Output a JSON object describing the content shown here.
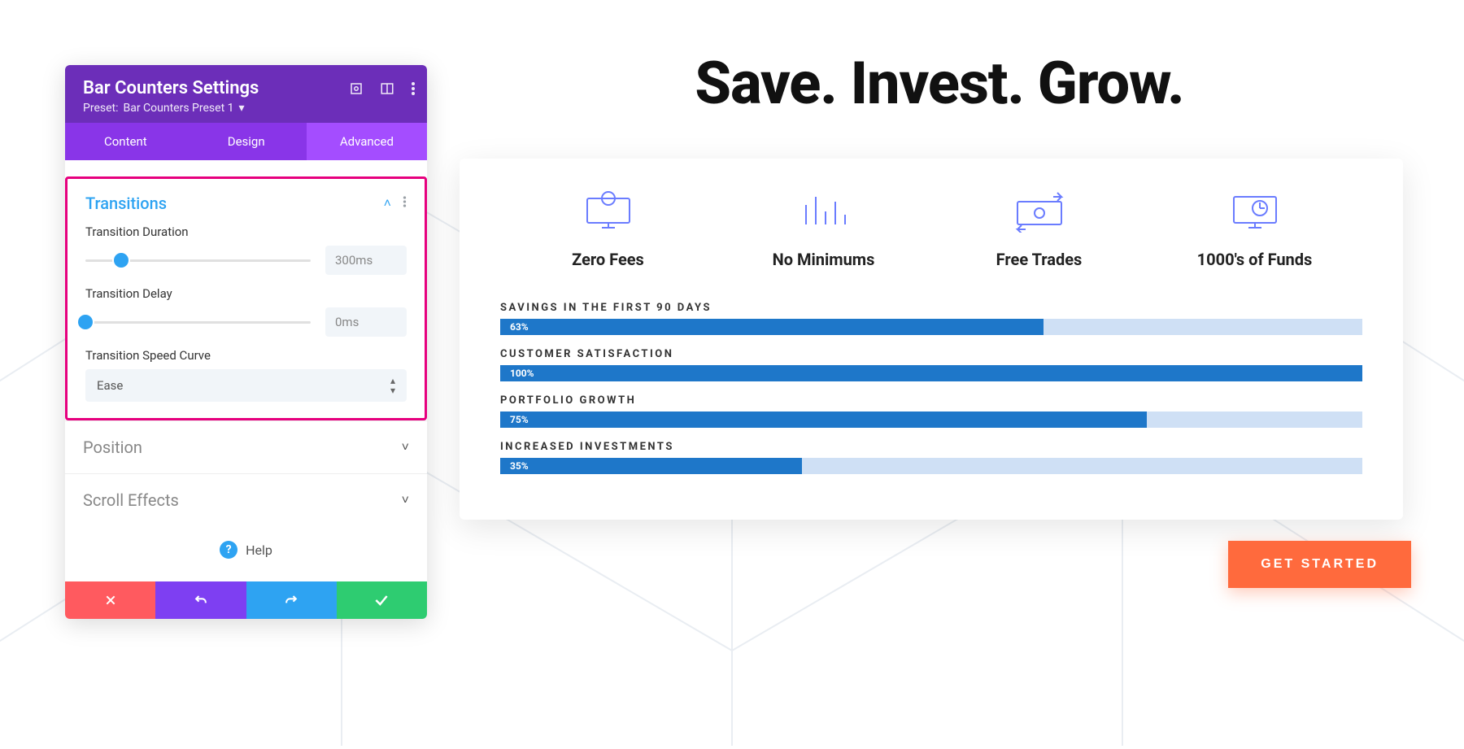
{
  "panel": {
    "title": "Bar Counters Settings",
    "preset_prefix": "Preset:",
    "preset_name": "Bar Counters Preset 1",
    "tabs": {
      "content": "Content",
      "design": "Design",
      "advanced": "Advanced"
    },
    "sections": {
      "transitions": {
        "title": "Transitions",
        "duration_label": "Transition Duration",
        "duration_value": "300ms",
        "delay_label": "Transition Delay",
        "delay_value": "0ms",
        "speed_curve_label": "Transition Speed Curve",
        "speed_curve_value": "Ease"
      },
      "position": {
        "title": "Position"
      },
      "scroll_effects": {
        "title": "Scroll Effects"
      }
    },
    "help_label": "Help"
  },
  "preview": {
    "hero": "Save. Invest. Grow.",
    "features": [
      {
        "id": "zero-fees",
        "label": "Zero Fees",
        "icon": "user-monitor"
      },
      {
        "id": "no-minimums",
        "label": "No Minimums",
        "icon": "bar-chart"
      },
      {
        "id": "free-trades",
        "label": "Free Trades",
        "icon": "money-transfer"
      },
      {
        "id": "thousands-funds",
        "label": "1000's of Funds",
        "icon": "clock-monitor"
      }
    ],
    "cta": "GET STARTED"
  },
  "chart_data": {
    "type": "bar",
    "orientation": "horizontal",
    "categories": [
      "SAVINGS IN THE FIRST 90 DAYS",
      "CUSTOMER SATISFACTION",
      "PORTFOLIO GROWTH",
      "INCREASED INVESTMENTS"
    ],
    "values": [
      63,
      100,
      75,
      35
    ],
    "value_labels": [
      "63%",
      "100%",
      "75%",
      "35%"
    ],
    "xlim": [
      0,
      100
    ],
    "fill_color": "#1e77c9",
    "track_color": "#cfe0f5"
  }
}
